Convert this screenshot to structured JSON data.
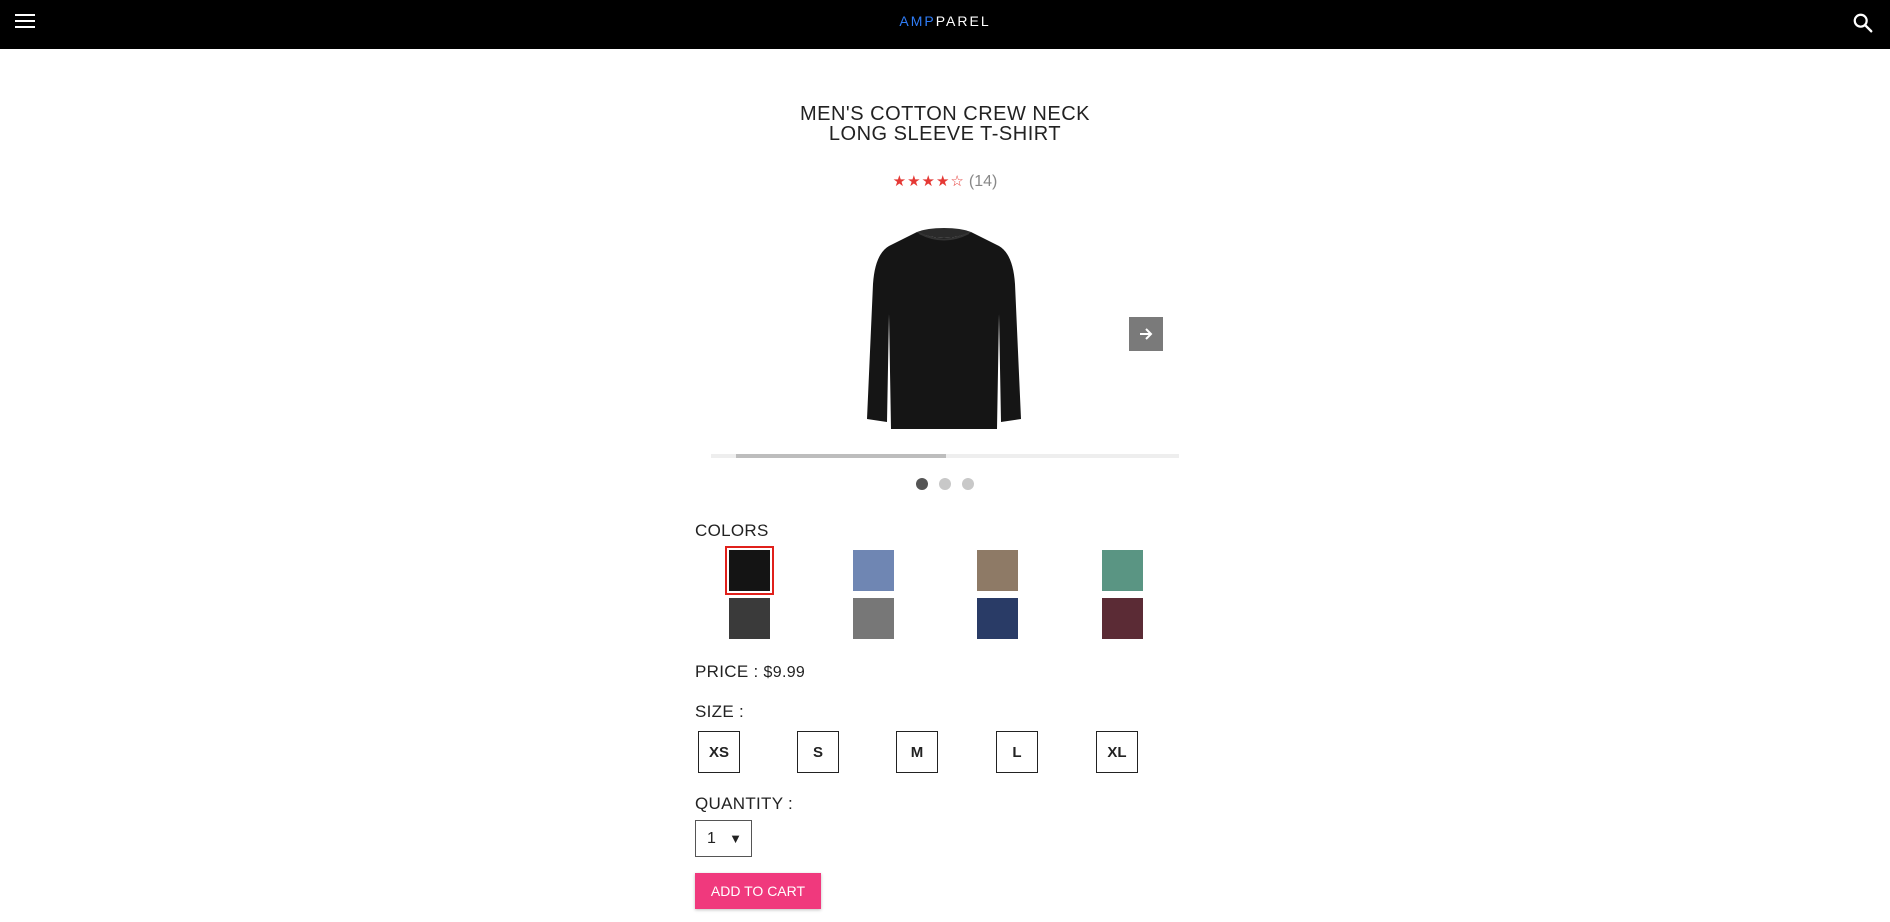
{
  "header": {
    "logo_prefix": "AMP",
    "logo_suffix": "PAREL",
    "menu_icon": "hamburger-menu-icon",
    "search_icon": "search-icon"
  },
  "product": {
    "title_line1": "MEN'S COTTON CREW NECK",
    "title_line2": "LONG SLEEVE T-SHIRT",
    "rating": {
      "stars_text": "★★★★☆",
      "value": 4,
      "max": 5,
      "count": "(14)"
    },
    "carousel": {
      "next_icon": "arrow-right-icon",
      "slides": 3,
      "active_slide": 1
    }
  },
  "colors": {
    "label": "COLORS",
    "selected_index": 0,
    "swatches": [
      {
        "name": "black",
        "hex": "#141414"
      },
      {
        "name": "heather-blue",
        "hex": "#6f86b3"
      },
      {
        "name": "heather-brown",
        "hex": "#8e7a66"
      },
      {
        "name": "heather-green",
        "hex": "#5a9583"
      },
      {
        "name": "charcoal",
        "hex": "#3a3a3a"
      },
      {
        "name": "heather-grey",
        "hex": "#777777"
      },
      {
        "name": "navy",
        "hex": "#293b66"
      },
      {
        "name": "maroon",
        "hex": "#5b2b35"
      }
    ]
  },
  "price": {
    "label": "PRICE :",
    "value": "$9.99"
  },
  "size": {
    "label": "SIZE :",
    "options": [
      "XS",
      "S",
      "M",
      "L",
      "XL"
    ]
  },
  "quantity": {
    "label": "QUANTITY :",
    "value": "1",
    "caret": "▼"
  },
  "cart": {
    "button_label": "ADD TO CART"
  },
  "accent_colors": {
    "logo_blue": "#2f7cf6",
    "star_red": "#e53935",
    "cart_pink": "#f0397d",
    "selected_outline": "#e0201b"
  }
}
